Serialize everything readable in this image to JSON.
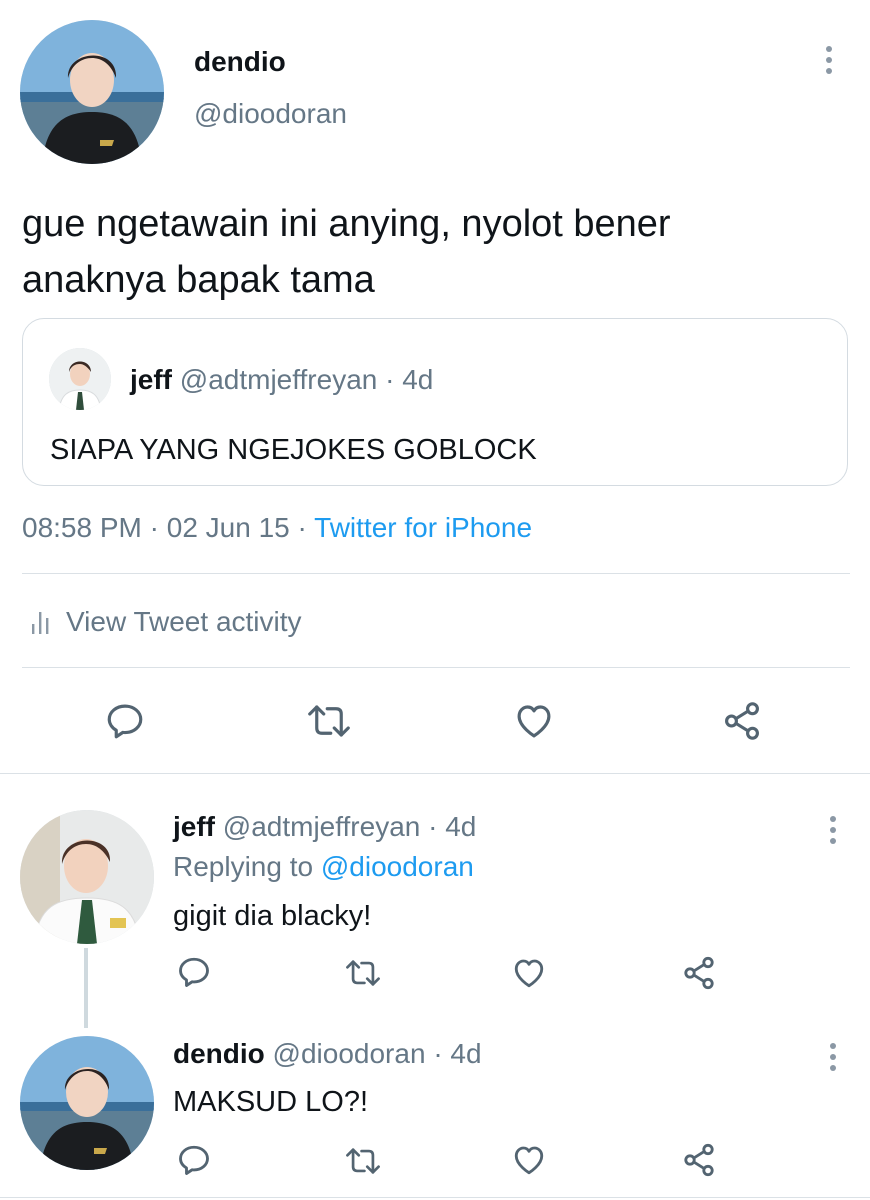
{
  "tweet": {
    "author_name": "dendio",
    "author_handle": "@dioodoran",
    "text_line1": "gue ngetawain ini anying, nyolot bener",
    "text_line2": "anaknya bapak tama",
    "quoted": {
      "name": "jeff",
      "handle": "@adtmjeffreyan",
      "sep": "·",
      "age": "4d",
      "text": "SIAPA YANG NGEJOKES GOBLOCK"
    },
    "time": "08:58 PM",
    "sep1": "·",
    "date": "02 Jun 15",
    "sep2": "·",
    "source": "Twitter for iPhone",
    "activity_label": "View Tweet activity"
  },
  "replies": [
    {
      "name": "jeff",
      "handle": "@adtmjeffreyan",
      "sep": "·",
      "age": "4d",
      "replying_prefix": "Replying to",
      "replying_to": "@dioodoran",
      "text": "gigit dia blacky!"
    },
    {
      "name": "dendio",
      "handle": "@dioodoran",
      "sep": "·",
      "age": "4d",
      "text": "MAKSUD LO?!"
    }
  ],
  "icons": {
    "reply": "reply-icon",
    "retweet": "retweet-icon",
    "like": "like-icon",
    "share": "share-icon",
    "more": "more-vertical-icon",
    "activity": "activity-bars-icon"
  },
  "colors": {
    "link": "#1d9bf0",
    "secondary_text": "#657786",
    "icon": "#536471",
    "divider": "#dbe1e6"
  }
}
